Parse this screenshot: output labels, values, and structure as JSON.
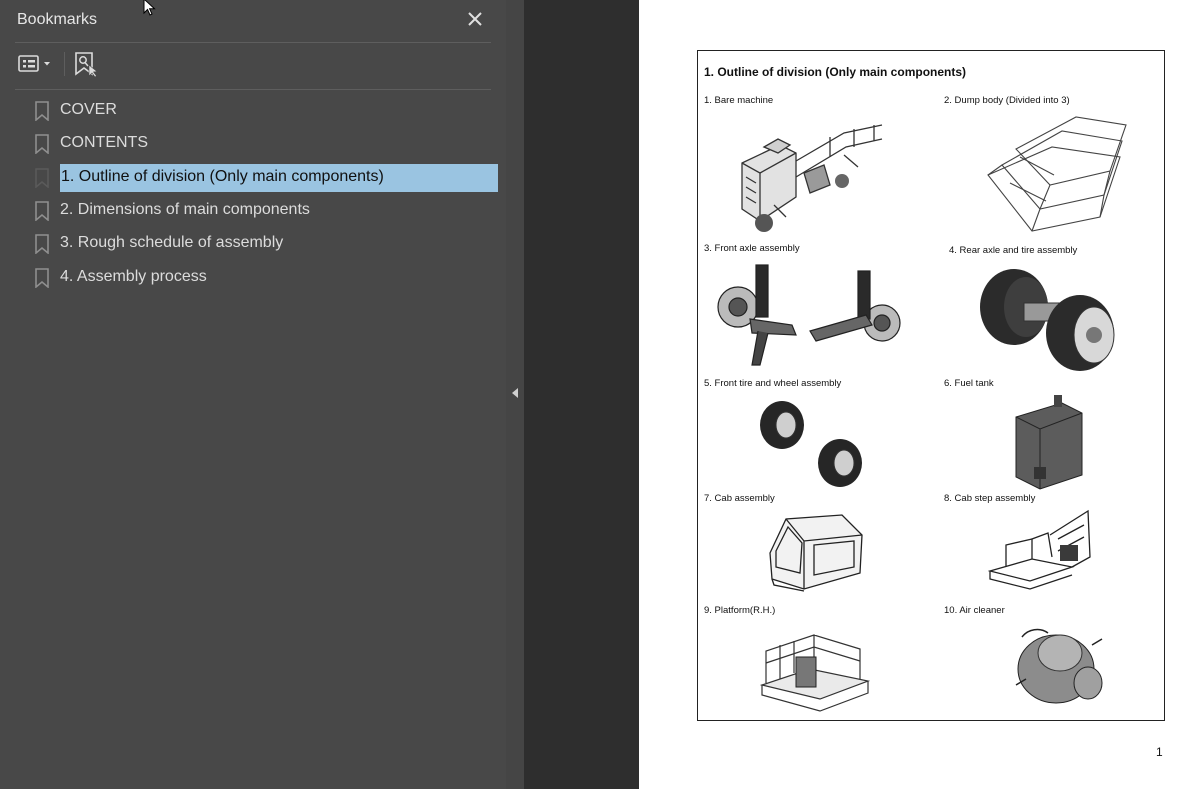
{
  "panel": {
    "title": "Bookmarks",
    "icons": {
      "close": "close-icon",
      "options": "list-options-icon",
      "find_bookmark": "bookmark-search-icon"
    },
    "bookmarks": [
      {
        "label": "COVER"
      },
      {
        "label": "CONTENTS"
      },
      {
        "label": "1. Outline of division (Only main components)",
        "selected": true
      },
      {
        "label": "2. Dimensions of main components"
      },
      {
        "label": "3. Rough schedule of assembly"
      },
      {
        "label": "4. Assembly process"
      }
    ]
  },
  "colors": {
    "panel_bg": "#484848",
    "selection": "#9ac4e1",
    "page_bg": "#ffffff"
  },
  "document": {
    "heading": "1.  Outline of division (Only main components)",
    "items": [
      {
        "caption": "1.  Bare machine"
      },
      {
        "caption": "2.  Dump body (Divided into 3)"
      },
      {
        "caption": "3.  Front axle assembly"
      },
      {
        "caption": "4.  Rear axle and tire assembly"
      },
      {
        "caption": "5.  Front tire and wheel assembly"
      },
      {
        "caption": "6.  Fuel tank"
      },
      {
        "caption": "7.  Cab assembly"
      },
      {
        "caption": "8.  Cab step assembly"
      },
      {
        "caption": "9.  Platform(R.H.)"
      },
      {
        "caption": "10. Air cleaner"
      }
    ],
    "page_number": "1"
  }
}
